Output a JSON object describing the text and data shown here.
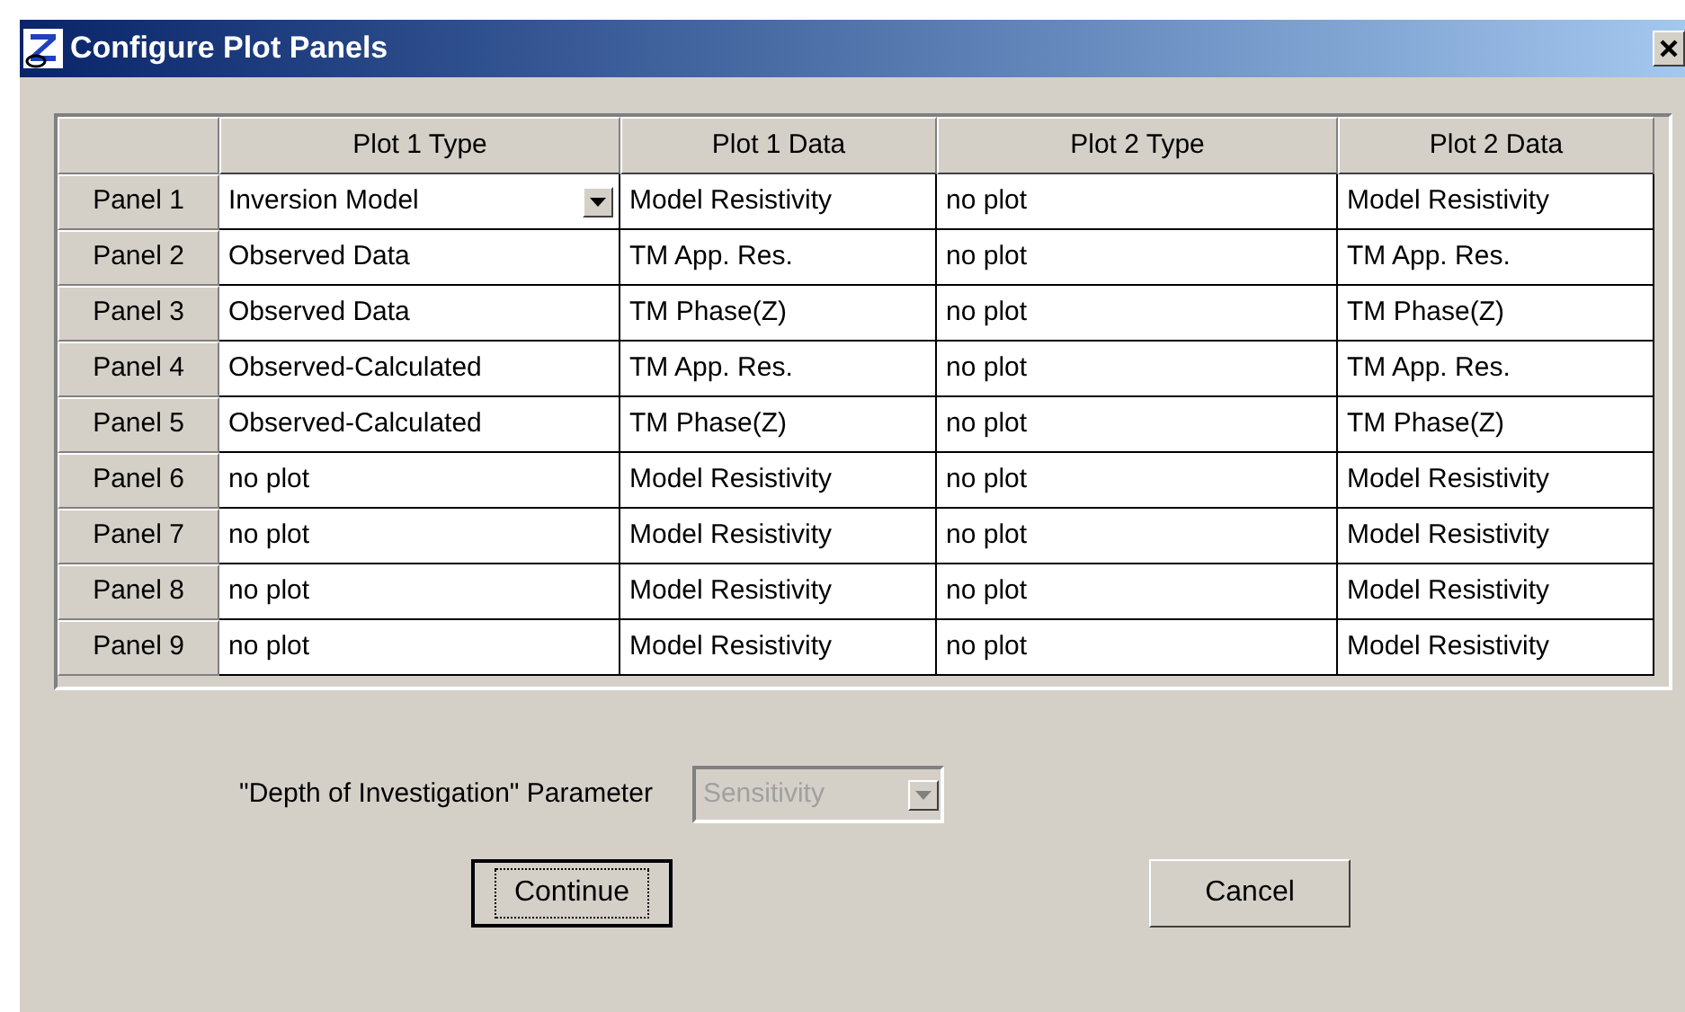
{
  "window": {
    "title": "Configure Plot Panels"
  },
  "table": {
    "columns": [
      "Plot 1 Type",
      "Plot 1 Data",
      "Plot 2 Type",
      "Plot 2 Data"
    ],
    "rows": [
      {
        "label": "Panel 1",
        "cells": [
          {
            "text": "Inversion Model",
            "kind": "dropdown"
          },
          {
            "text": "Model Resistivity",
            "kind": "text"
          },
          {
            "text": "no plot",
            "kind": "text"
          },
          {
            "text": "Model Resistivity",
            "kind": "text"
          }
        ]
      },
      {
        "label": "Panel 2",
        "cells": [
          {
            "text": "Observed Data",
            "kind": "text"
          },
          {
            "text": "TM App. Res.",
            "kind": "text"
          },
          {
            "text": "no plot",
            "kind": "text"
          },
          {
            "text": "TM App. Res.",
            "kind": "text"
          }
        ]
      },
      {
        "label": "Panel 3",
        "cells": [
          {
            "text": "Observed Data",
            "kind": "text"
          },
          {
            "text": "TM Phase(Z)",
            "kind": "text"
          },
          {
            "text": "no plot",
            "kind": "text"
          },
          {
            "text": "TM Phase(Z)",
            "kind": "text"
          }
        ]
      },
      {
        "label": "Panel 4",
        "cells": [
          {
            "text": "Observed-Calculated",
            "kind": "text"
          },
          {
            "text": "TM App. Res.",
            "kind": "text"
          },
          {
            "text": "no plot",
            "kind": "text"
          },
          {
            "text": "TM App. Res.",
            "kind": "text"
          }
        ]
      },
      {
        "label": "Panel 5",
        "cells": [
          {
            "text": "Observed-Calculated",
            "kind": "text"
          },
          {
            "text": "TM Phase(Z)",
            "kind": "text"
          },
          {
            "text": "no plot",
            "kind": "text"
          },
          {
            "text": "TM Phase(Z)",
            "kind": "text"
          }
        ]
      },
      {
        "label": "Panel 6",
        "cells": [
          {
            "text": "no plot",
            "kind": "text"
          },
          {
            "text": "Model Resistivity",
            "kind": "text"
          },
          {
            "text": "no plot",
            "kind": "text"
          },
          {
            "text": "Model Resistivity",
            "kind": "text"
          }
        ]
      },
      {
        "label": "Panel 7",
        "cells": [
          {
            "text": "no plot",
            "kind": "text"
          },
          {
            "text": "Model Resistivity",
            "kind": "text"
          },
          {
            "text": "no plot",
            "kind": "text"
          },
          {
            "text": "Model Resistivity",
            "kind": "text"
          }
        ]
      },
      {
        "label": "Panel 8",
        "cells": [
          {
            "text": "no plot",
            "kind": "text"
          },
          {
            "text": "Model Resistivity",
            "kind": "text"
          },
          {
            "text": "no plot",
            "kind": "text"
          },
          {
            "text": "Model Resistivity",
            "kind": "text"
          }
        ]
      },
      {
        "label": "Panel 9",
        "cells": [
          {
            "text": "no plot",
            "kind": "text"
          },
          {
            "text": "Model Resistivity",
            "kind": "text"
          },
          {
            "text": "no plot",
            "kind": "text"
          },
          {
            "text": "Model Resistivity",
            "kind": "text"
          }
        ]
      }
    ]
  },
  "parameter": {
    "label": "\"Depth of Investigation\" Parameter",
    "value": "Sensitivity",
    "disabled": true
  },
  "buttons": [
    {
      "label": "Continue",
      "focused": true
    },
    {
      "label": "Cancel",
      "focused": false
    }
  ]
}
